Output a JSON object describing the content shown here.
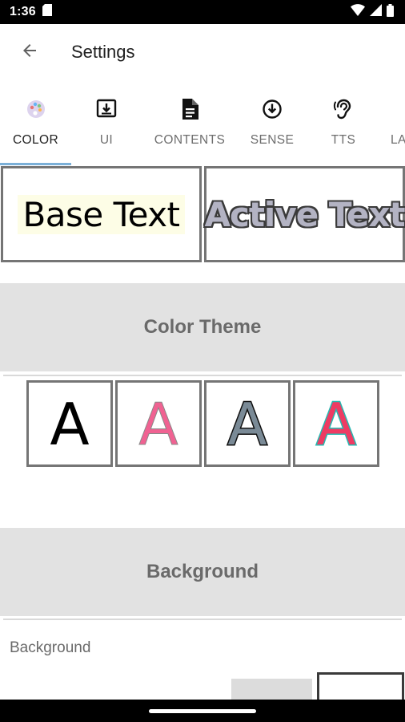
{
  "status_bar": {
    "time": "1:36",
    "icons": [
      "sd-card-icon",
      "wifi-icon",
      "signal-icon",
      "battery-icon"
    ]
  },
  "app_bar": {
    "title": "Settings",
    "back_icon": "arrow-back-icon"
  },
  "tabs": [
    {
      "label": "COLOR",
      "icon": "palette-icon",
      "active": true
    },
    {
      "label": "UI",
      "icon": "download-box-icon",
      "active": false
    },
    {
      "label": "CONTENTS",
      "icon": "document-icon",
      "active": false
    },
    {
      "label": "SENSE",
      "icon": "arrow-circle-down-icon",
      "active": false
    },
    {
      "label": "TTS",
      "icon": "ear-icon",
      "active": false
    },
    {
      "label": "LA",
      "icon": "",
      "active": false
    }
  ],
  "preview": {
    "base_text": "Base Text",
    "active_text": "Active Text"
  },
  "sections": {
    "color_theme": "Color Theme",
    "background": "Background"
  },
  "themes": [
    {
      "letter": "A",
      "fill": "#000000",
      "stroke": "none"
    },
    {
      "letter": "A",
      "fill": "#f06292",
      "stroke": "#8a8a8a"
    },
    {
      "letter": "A",
      "fill": "#7a8a96",
      "stroke": "#101010"
    },
    {
      "letter": "A",
      "fill": "#ee3b63",
      "stroke": "#26b8b0"
    }
  ],
  "background_setting": {
    "label": "Background"
  },
  "colors": {
    "accent_indicator": "#7bb0d8",
    "section_bg": "#e2e2e2",
    "box_border": "#757575"
  }
}
